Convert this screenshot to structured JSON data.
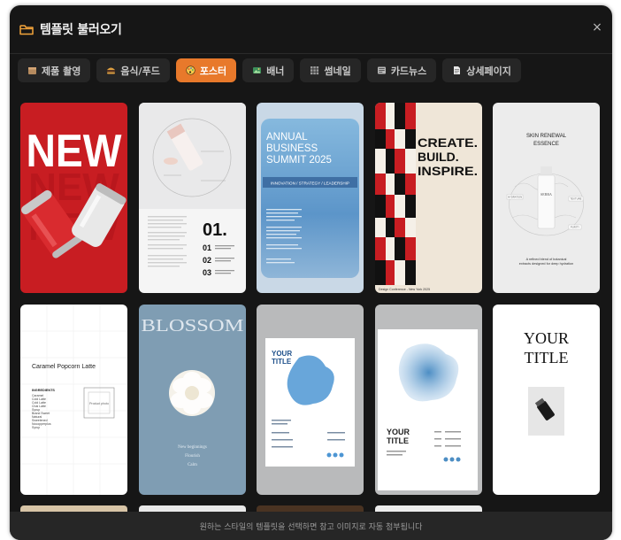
{
  "dialog": {
    "title": "템플릿 불러오기",
    "close_label": "×",
    "footer_text": "원하는 스타일의 템플릿을 선택하면 참고 이미지로 자동 첨부됩니다"
  },
  "tabs": [
    {
      "label": "제품 촬영",
      "icon": "box-icon",
      "active": false
    },
    {
      "label": "음식/푸드",
      "icon": "burger-icon",
      "active": false
    },
    {
      "label": "포스터",
      "icon": "palette-icon",
      "active": true
    },
    {
      "label": "배너",
      "icon": "image-icon",
      "active": false
    },
    {
      "label": "썸네일",
      "icon": "grid-icon",
      "active": false
    },
    {
      "label": "카드뉴스",
      "icon": "card-icon",
      "active": false
    },
    {
      "label": "상세페이지",
      "icon": "document-icon",
      "active": false
    }
  ],
  "colors": {
    "accent": "#e8792b",
    "background": "#161616",
    "tab": "#262626"
  },
  "templates": {
    "new_cans": {
      "word": "NEW"
    },
    "product_steps": {
      "number": "01.",
      "steps": [
        "01",
        "02",
        "03"
      ]
    },
    "annual_summit": {
      "line1": "ANNUAL",
      "line2": "BUSINESS",
      "line3": "SUMMIT 2025",
      "subtitle": "INNOVATION / STRATEGY / LEADERSHIP"
    },
    "create_build": {
      "line1": "CREATE.",
      "line2": "BUILD.",
      "line3": "INSPIRE.",
      "footer": "Design Conference - New York 2025"
    },
    "skin_renewal": {
      "line1": "SKIN RENEWAL",
      "line2": "ESSENCE",
      "brand": "SERRA",
      "label_hydration": "HYDRATION",
      "label_texture": "TEXTURE",
      "label_purity": "PURITY",
      "caption1": "A refined blend of botanical",
      "caption2": "extracts designed for deep hydration"
    },
    "caramel_latte": {
      "title": "Caramel Popcorn Latte",
      "ingredients_label": "INGREDIENTS",
      "ingredients": [
        "Caramel",
        "Cold Latte",
        "Cold Latte",
        "Chai Latte",
        "Syrup",
        "Brand Sweet",
        "Natural",
        "Sweetened",
        "Nocopperplus",
        "Syrup"
      ],
      "photo_label": "Product photo"
    },
    "blossom": {
      "title": "BLOSSOM",
      "line1": "New beginnings",
      "line2": "Flourish",
      "line3": "Calm"
    },
    "your_title_1": {
      "title1": "YOUR",
      "title2": "TITLE"
    },
    "your_title_2": {
      "title1": "YOUR",
      "title2": "TITLE"
    },
    "your_title_3": {
      "title1": "YOUR",
      "title2": "TITLE"
    }
  }
}
